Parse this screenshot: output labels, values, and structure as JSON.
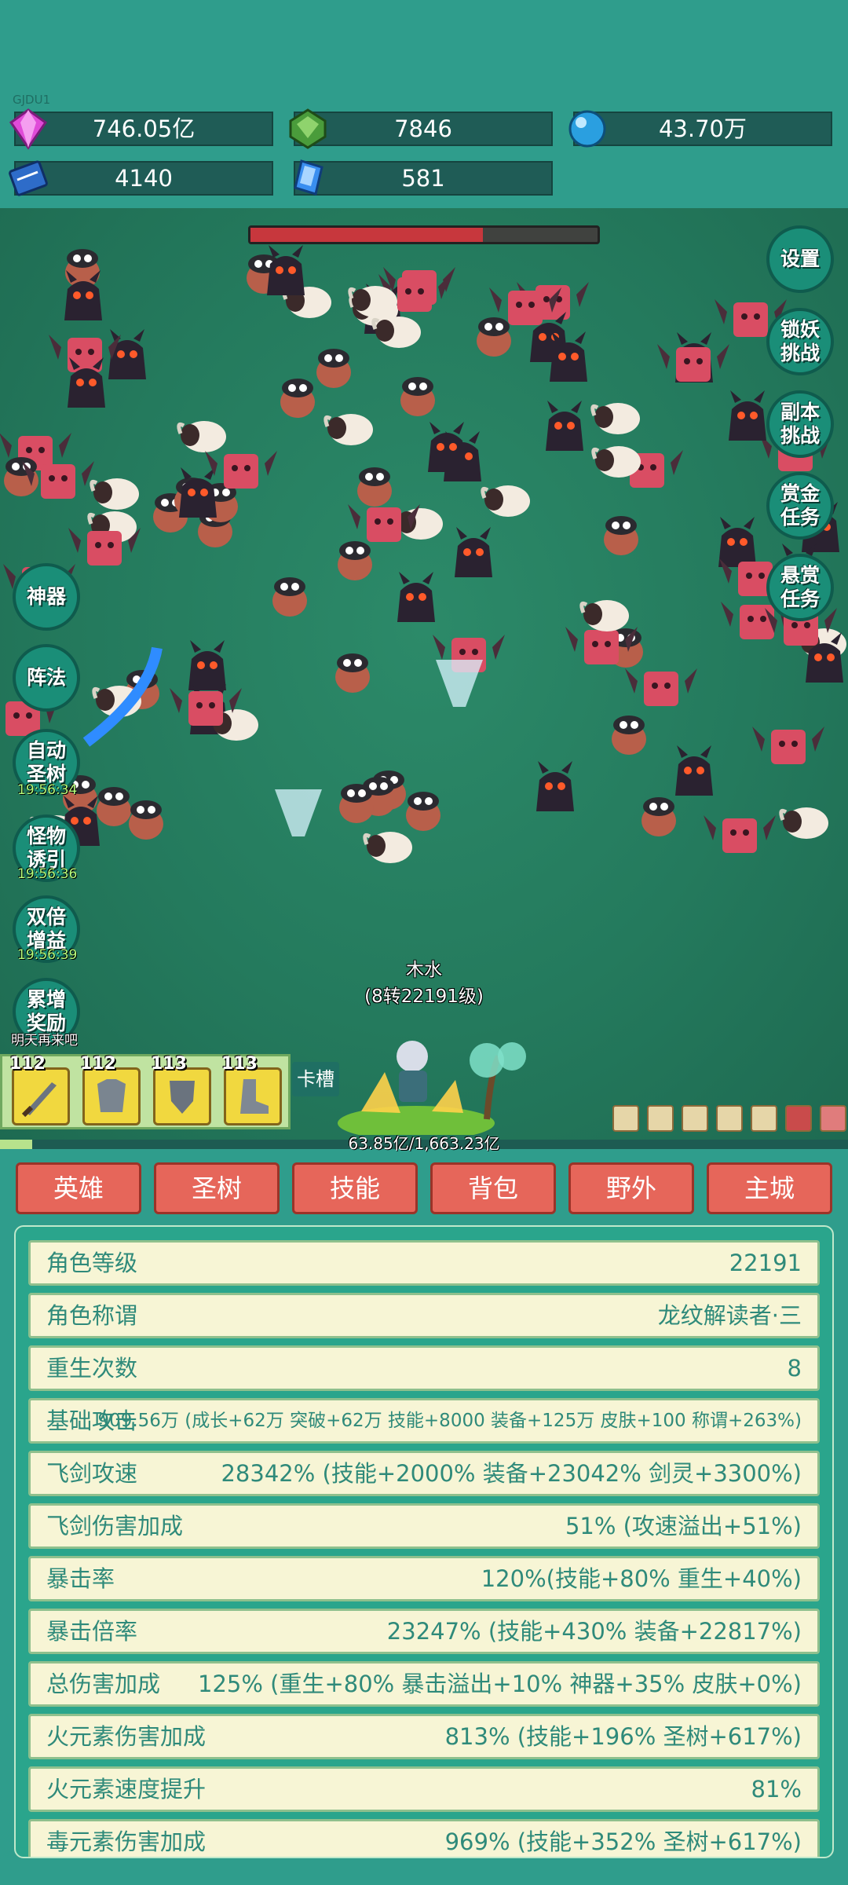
{
  "top": {
    "tag": "GJDU1",
    "resources": [
      {
        "icon": "gem-purple-icon",
        "value": "746.05亿"
      },
      {
        "icon": "gem-green-icon",
        "value": "7846"
      },
      {
        "icon": "orb-blue-icon",
        "value": "43.70万"
      },
      {
        "icon": "book-icon",
        "value": "4140"
      },
      {
        "icon": "crystal-icon",
        "value": "581"
      }
    ]
  },
  "battle": {
    "boss_hp_fraction": 0.67,
    "right_buttons": [
      "设置",
      "锁妖\n挑战",
      "副本\n挑战",
      "赏金\n任务",
      "悬赏\n任务"
    ],
    "left_buttons": [
      {
        "label": "神器"
      },
      {
        "label": "阵法"
      },
      {
        "label": "自动\n圣树",
        "timer": "19:56:34"
      },
      {
        "label": "怪物\n诱引",
        "timer": "19:56:36"
      },
      {
        "label": "双倍\n增益",
        "timer": "19:56:39"
      },
      {
        "label": "累增\n奖励",
        "timer": "明天再来吧"
      }
    ],
    "hero_name": "木水",
    "hero_level": "(8转22191级)",
    "slots": [
      {
        "level": "112",
        "icon": "sword-icon"
      },
      {
        "level": "112",
        "icon": "armor-icon"
      },
      {
        "level": "113",
        "icon": "shield-icon"
      },
      {
        "level": "113",
        "icon": "boots-icon"
      }
    ],
    "slot_button": "卡槽",
    "xp_text": "63.85亿/1,663.23亿",
    "xp_fraction": 0.038
  },
  "tabs": [
    "英雄",
    "圣树",
    "技能",
    "背包",
    "野外",
    "主城"
  ],
  "active_tab": 0,
  "stats": [
    {
      "label": "角色等级",
      "value": "22191"
    },
    {
      "label": "角色称谓",
      "value": "龙纹解读者·三"
    },
    {
      "label": "重生次数",
      "value": "8"
    },
    {
      "label": "基础攻击",
      "value": "909.56万 (成长+62万 突破+62万 技能+8000 装备+125万 皮肤+100 称谓+263%)"
    },
    {
      "label": "飞剑攻速",
      "value": "28342% (技能+2000% 装备+23042% 剑灵+3300%)"
    },
    {
      "label": "飞剑伤害加成",
      "value": "51% (攻速溢出+51%)"
    },
    {
      "label": "暴击率",
      "value": "120%(技能+80% 重生+40%)"
    },
    {
      "label": "暴击倍率",
      "value": "23247% (技能+430% 装备+22817%)"
    },
    {
      "label": "总伤害加成",
      "value": "125% (重生+80% 暴击溢出+10% 神器+35% 皮肤+0%)"
    },
    {
      "label": "火元素伤害加成",
      "value": "813% (技能+196% 圣树+617%)"
    },
    {
      "label": "火元素速度提升",
      "value": "81%"
    },
    {
      "label": "毒元素伤害加成",
      "value": "969% (技能+352% 圣树+617%)"
    }
  ],
  "colors": {
    "tab_active": "#f7b731",
    "tab": "#e6665a",
    "panel": "#2aa58c",
    "row": "#f7f5d5"
  }
}
